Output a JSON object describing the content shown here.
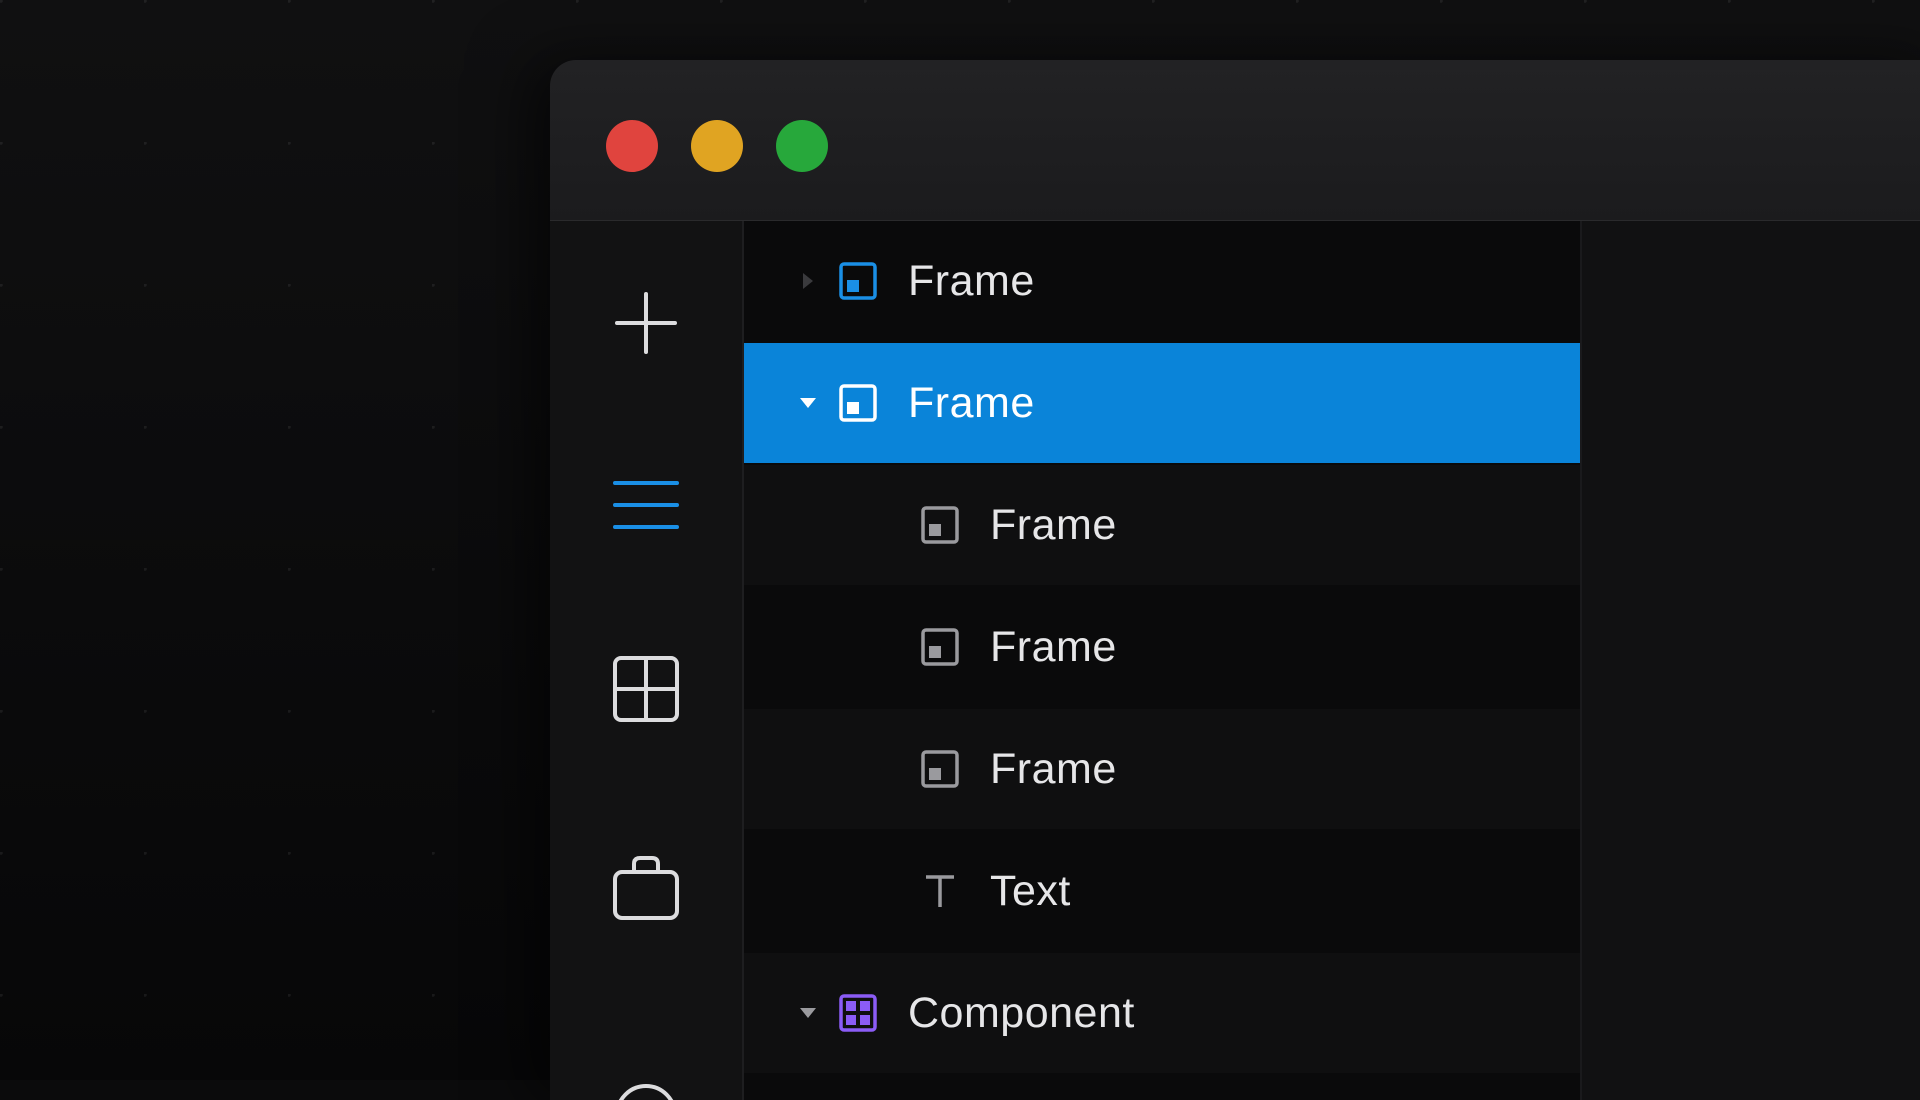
{
  "layers": {
    "rows": [
      {
        "label": "Frame",
        "type": "frame",
        "depth": 0,
        "expanded": false,
        "selected": false,
        "icon": "frame-icon"
      },
      {
        "label": "Frame",
        "type": "frame",
        "depth": 0,
        "expanded": true,
        "selected": true,
        "icon": "frame-icon"
      },
      {
        "label": "Frame",
        "type": "frame",
        "depth": 1,
        "selected": false,
        "icon": "frame-icon"
      },
      {
        "label": "Frame",
        "type": "frame",
        "depth": 1,
        "selected": false,
        "icon": "frame-icon"
      },
      {
        "label": "Frame",
        "type": "frame",
        "depth": 1,
        "selected": false,
        "icon": "frame-icon"
      },
      {
        "label": "Text",
        "type": "text",
        "depth": 1,
        "selected": false,
        "icon": "text-icon"
      },
      {
        "label": "Component",
        "type": "component",
        "depth": 0,
        "expanded": true,
        "selected": false,
        "icon": "component-icon"
      }
    ]
  },
  "toolbar": {
    "items": [
      {
        "icon": "plus-icon"
      },
      {
        "icon": "layers-icon",
        "active": true
      },
      {
        "icon": "grid-icon"
      },
      {
        "icon": "bag-icon"
      },
      {
        "icon": "circle-icon"
      }
    ]
  },
  "colors": {
    "selection": "#0a84d9",
    "active_icon": "#1a8fe6",
    "frame_icon_top": "#1a8fe6",
    "component_icon": "#8b5cf6",
    "close": "#e0443e",
    "minimize": "#e0a422",
    "zoom": "#27a83b"
  }
}
